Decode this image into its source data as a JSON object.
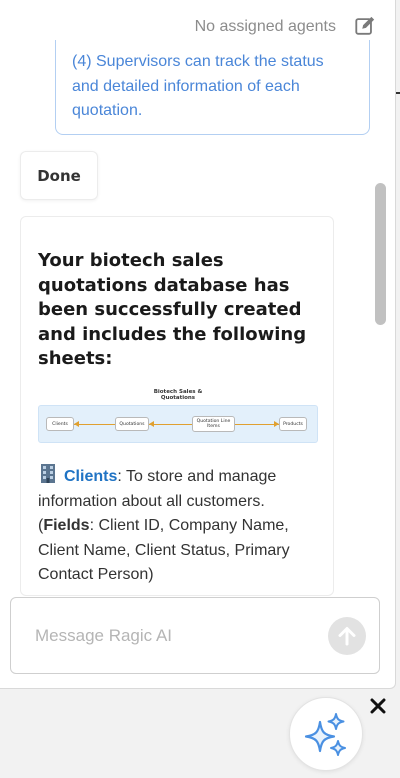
{
  "header": {
    "agents_label": "No assigned agents",
    "edit_icon": "edit-icon"
  },
  "messages": {
    "user_text": "(4) Supervisors can track the status and detailed information of each quotation.",
    "done_label": "Done",
    "response": {
      "heading": "Your biotech sales quotations database has been successfully created and includes the following sheets:",
      "diagram": {
        "title_line1": "Biotech Sales &",
        "title_line2": "Quotations",
        "nodes": [
          "Clients",
          "Quotations",
          "Quotation Line Items",
          "Products"
        ]
      },
      "clients": {
        "icon": "building-icon",
        "name": "Clients",
        "desc": ": To store and manage information about all customers. (",
        "fields_label": "Fields",
        "fields": ": Client ID, Company Name, Client Name, Client Status, Primary Contact Person)"
      }
    }
  },
  "composer": {
    "placeholder": "Message Ragic AI",
    "send_icon": "send-arrow-icon"
  },
  "fab": {
    "icon": "sparkles-icon",
    "close_icon": "close-icon"
  },
  "colors": {
    "link": "#1f73c4",
    "user_text": "#4a86d8",
    "accent_sparkle": "#4a90e2",
    "diagram_band": "#e3f0fb",
    "diagram_edge": "#e0a030"
  }
}
